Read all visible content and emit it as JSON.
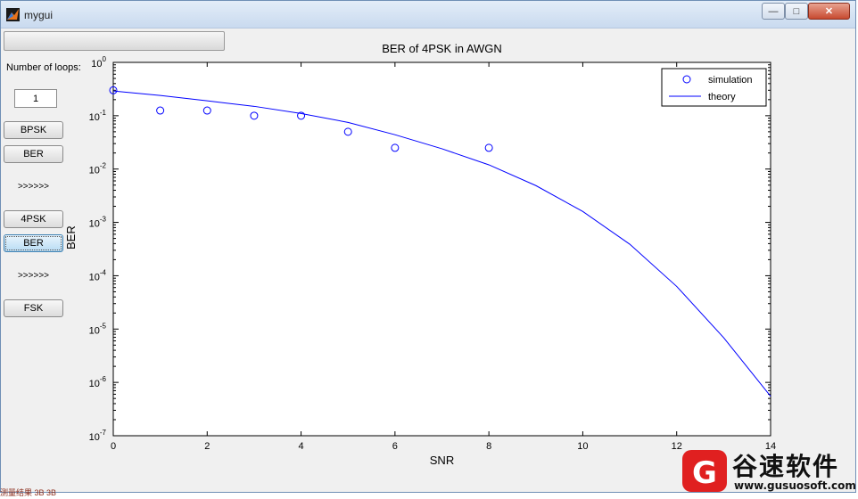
{
  "window": {
    "title": "mygui",
    "minimize_glyph": "—",
    "maximize_glyph": "□",
    "close_glyph": "✕"
  },
  "controls": {
    "loops_label": "Number of loops:",
    "loops_value": "1",
    "bpsk_button": "BPSK",
    "ber_button_1": "BER",
    "arrows_1": ">>>>>>",
    "qpsk_button": "4PSK",
    "ber_button_2": "BER",
    "arrows_2": ">>>>>>",
    "fsk_button": "FSK"
  },
  "chart_data": {
    "type": "scatter",
    "title": "BER of 4PSK in AWGN",
    "xlabel": "SNR",
    "ylabel": "BER",
    "xlim": [
      0,
      14
    ],
    "ylim": [
      1e-07,
      1
    ],
    "yscale": "log",
    "x_ticks": [
      "0",
      "2",
      "4",
      "6",
      "8",
      "10",
      "12",
      "14"
    ],
    "y_ticks": [
      {
        "base": "10",
        "exp": "0"
      },
      {
        "base": "10",
        "exp": "-1"
      },
      {
        "base": "10",
        "exp": "-2"
      },
      {
        "base": "10",
        "exp": "-3"
      },
      {
        "base": "10",
        "exp": "-4"
      },
      {
        "base": "10",
        "exp": "-5"
      },
      {
        "base": "10",
        "exp": "-6"
      },
      {
        "base": "10",
        "exp": "-7"
      }
    ],
    "legend_position": "top-right",
    "series": [
      {
        "name": "simulation",
        "style": "markers-circle",
        "color": "#0000ff",
        "x": [
          0,
          1,
          2,
          3,
          4,
          5,
          6,
          8
        ],
        "y": [
          0.3,
          0.125,
          0.125,
          0.1,
          0.1,
          0.05,
          0.025,
          0.025
        ]
      },
      {
        "name": "theory",
        "style": "line",
        "color": "#0000ff",
        "x": [
          0,
          1,
          2,
          3,
          4,
          5,
          6,
          7,
          8,
          9,
          10,
          11,
          12,
          13,
          14
        ],
        "y": [
          0.29,
          0.24,
          0.19,
          0.15,
          0.11,
          0.075,
          0.044,
          0.024,
          0.012,
          0.0049,
          0.0016,
          0.00039,
          6.3e-05,
          6.9e-06,
          5.5e-07
        ]
      }
    ]
  },
  "watermark": {
    "logo_letter": "G",
    "text": "谷速软件",
    "url": "www.gusuosoft.com"
  },
  "status": {
    "fragment": "测量结果 3B 3B"
  }
}
